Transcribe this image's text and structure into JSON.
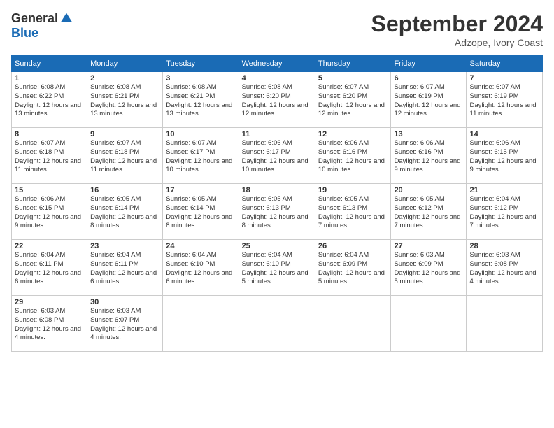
{
  "logo": {
    "general": "General",
    "blue": "Blue"
  },
  "title": "September 2024",
  "location": "Adzope, Ivory Coast",
  "days_of_week": [
    "Sunday",
    "Monday",
    "Tuesday",
    "Wednesday",
    "Thursday",
    "Friday",
    "Saturday"
  ],
  "weeks": [
    [
      {
        "day": "1",
        "sunrise": "6:08 AM",
        "sunset": "6:22 PM",
        "daylight": "12 hours and 13 minutes."
      },
      {
        "day": "2",
        "sunrise": "6:08 AM",
        "sunset": "6:21 PM",
        "daylight": "12 hours and 13 minutes."
      },
      {
        "day": "3",
        "sunrise": "6:08 AM",
        "sunset": "6:21 PM",
        "daylight": "12 hours and 13 minutes."
      },
      {
        "day": "4",
        "sunrise": "6:08 AM",
        "sunset": "6:20 PM",
        "daylight": "12 hours and 12 minutes."
      },
      {
        "day": "5",
        "sunrise": "6:07 AM",
        "sunset": "6:20 PM",
        "daylight": "12 hours and 12 minutes."
      },
      {
        "day": "6",
        "sunrise": "6:07 AM",
        "sunset": "6:19 PM",
        "daylight": "12 hours and 12 minutes."
      },
      {
        "day": "7",
        "sunrise": "6:07 AM",
        "sunset": "6:19 PM",
        "daylight": "12 hours and 11 minutes."
      }
    ],
    [
      {
        "day": "8",
        "sunrise": "6:07 AM",
        "sunset": "6:18 PM",
        "daylight": "12 hours and 11 minutes."
      },
      {
        "day": "9",
        "sunrise": "6:07 AM",
        "sunset": "6:18 PM",
        "daylight": "12 hours and 11 minutes."
      },
      {
        "day": "10",
        "sunrise": "6:07 AM",
        "sunset": "6:17 PM",
        "daylight": "12 hours and 10 minutes."
      },
      {
        "day": "11",
        "sunrise": "6:06 AM",
        "sunset": "6:17 PM",
        "daylight": "12 hours and 10 minutes."
      },
      {
        "day": "12",
        "sunrise": "6:06 AM",
        "sunset": "6:16 PM",
        "daylight": "12 hours and 10 minutes."
      },
      {
        "day": "13",
        "sunrise": "6:06 AM",
        "sunset": "6:16 PM",
        "daylight": "12 hours and 9 minutes."
      },
      {
        "day": "14",
        "sunrise": "6:06 AM",
        "sunset": "6:15 PM",
        "daylight": "12 hours and 9 minutes."
      }
    ],
    [
      {
        "day": "15",
        "sunrise": "6:06 AM",
        "sunset": "6:15 PM",
        "daylight": "12 hours and 9 minutes."
      },
      {
        "day": "16",
        "sunrise": "6:05 AM",
        "sunset": "6:14 PM",
        "daylight": "12 hours and 8 minutes."
      },
      {
        "day": "17",
        "sunrise": "6:05 AM",
        "sunset": "6:14 PM",
        "daylight": "12 hours and 8 minutes."
      },
      {
        "day": "18",
        "sunrise": "6:05 AM",
        "sunset": "6:13 PM",
        "daylight": "12 hours and 8 minutes."
      },
      {
        "day": "19",
        "sunrise": "6:05 AM",
        "sunset": "6:13 PM",
        "daylight": "12 hours and 7 minutes."
      },
      {
        "day": "20",
        "sunrise": "6:05 AM",
        "sunset": "6:12 PM",
        "daylight": "12 hours and 7 minutes."
      },
      {
        "day": "21",
        "sunrise": "6:04 AM",
        "sunset": "6:12 PM",
        "daylight": "12 hours and 7 minutes."
      }
    ],
    [
      {
        "day": "22",
        "sunrise": "6:04 AM",
        "sunset": "6:11 PM",
        "daylight": "12 hours and 6 minutes."
      },
      {
        "day": "23",
        "sunrise": "6:04 AM",
        "sunset": "6:11 PM",
        "daylight": "12 hours and 6 minutes."
      },
      {
        "day": "24",
        "sunrise": "6:04 AM",
        "sunset": "6:10 PM",
        "daylight": "12 hours and 6 minutes."
      },
      {
        "day": "25",
        "sunrise": "6:04 AM",
        "sunset": "6:10 PM",
        "daylight": "12 hours and 5 minutes."
      },
      {
        "day": "26",
        "sunrise": "6:04 AM",
        "sunset": "6:09 PM",
        "daylight": "12 hours and 5 minutes."
      },
      {
        "day": "27",
        "sunrise": "6:03 AM",
        "sunset": "6:09 PM",
        "daylight": "12 hours and 5 minutes."
      },
      {
        "day": "28",
        "sunrise": "6:03 AM",
        "sunset": "6:08 PM",
        "daylight": "12 hours and 4 minutes."
      }
    ],
    [
      {
        "day": "29",
        "sunrise": "6:03 AM",
        "sunset": "6:08 PM",
        "daylight": "12 hours and 4 minutes."
      },
      {
        "day": "30",
        "sunrise": "6:03 AM",
        "sunset": "6:07 PM",
        "daylight": "12 hours and 4 minutes."
      },
      null,
      null,
      null,
      null,
      null
    ]
  ]
}
